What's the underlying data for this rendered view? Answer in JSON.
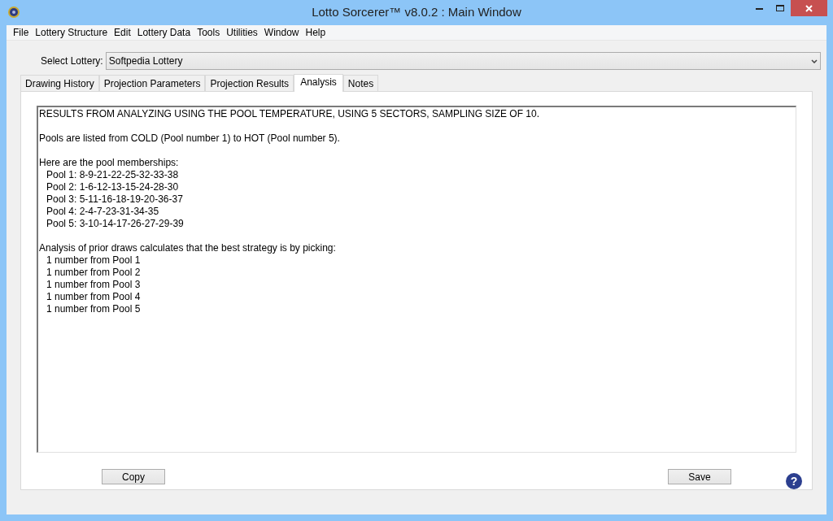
{
  "window": {
    "title": "Lotto Sorcerer™ v8.0.2 : Main Window"
  },
  "menu": [
    "File",
    "Lottery Structure",
    "Edit",
    "Lottery Data",
    "Tools",
    "Utilities",
    "Window",
    "Help"
  ],
  "select_lottery": {
    "label": "Select Lottery:",
    "value": "Softpedia Lottery"
  },
  "tabs": [
    {
      "label": "Drawing History",
      "selected": false
    },
    {
      "label": "Projection Parameters",
      "selected": false
    },
    {
      "label": "Projection Results",
      "selected": false
    },
    {
      "label": "Analysis",
      "selected": true
    },
    {
      "label": "Notes",
      "selected": false
    }
  ],
  "analysis": {
    "heading": "RESULTS FROM ANALYZING USING THE POOL TEMPERATURE, USING 5 SECTORS, SAMPLING SIZE OF 10.",
    "note": "Pools are listed from COLD (Pool number 1) to HOT (Pool number 5).",
    "memberships": {
      "heading": "Here are the pool memberships:",
      "pools": [
        "Pool 1: 8-9-21-22-25-32-33-38",
        "Pool 2: 1-6-12-13-15-24-28-30",
        "Pool 3: 5-11-16-18-19-20-36-37",
        "Pool 4: 2-4-7-23-31-34-35",
        "Pool 5: 3-10-14-17-26-27-29-39"
      ]
    },
    "strategy": {
      "heading": "Analysis of prior draws calculates that the best strategy is by picking:",
      "picks": [
        "1 number from Pool 1",
        "1 number from Pool 2",
        "1 number from Pool 3",
        "1 number from Pool 4",
        "1 number from Pool 5"
      ]
    }
  },
  "buttons": {
    "copy": "Copy",
    "save": "Save",
    "help": "?"
  }
}
